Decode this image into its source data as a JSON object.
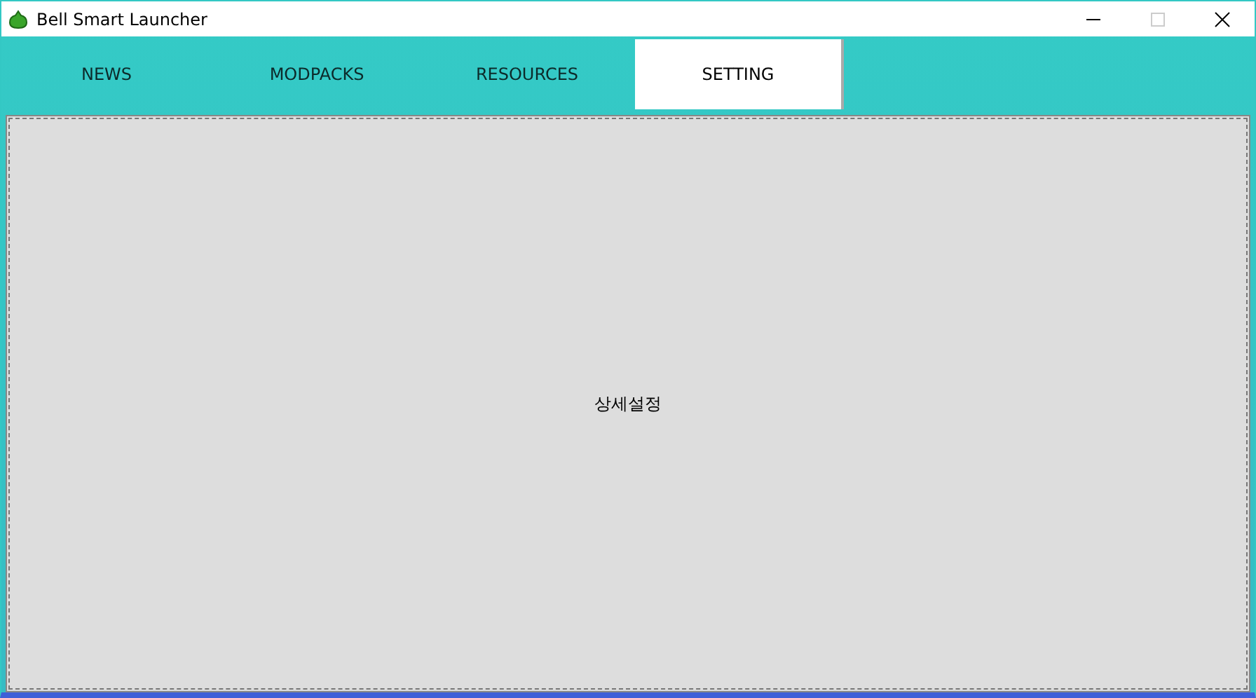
{
  "window": {
    "title": "Bell Smart Launcher"
  },
  "tabs": [
    {
      "label": "NEWS",
      "selected": false
    },
    {
      "label": "MODPACKS",
      "selected": false
    },
    {
      "label": "RESOURCES",
      "selected": false
    },
    {
      "label": "SETTING",
      "selected": true
    }
  ],
  "content": {
    "button": "상세설정"
  }
}
